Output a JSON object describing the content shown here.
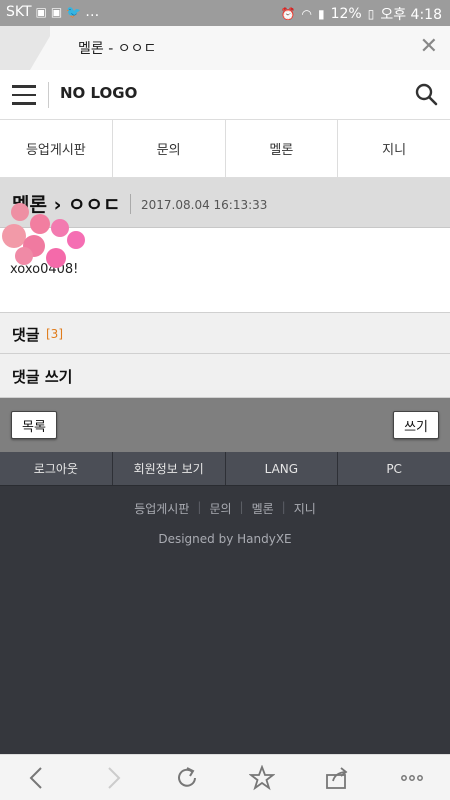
{
  "status_bar": {
    "carrier": "SKT",
    "battery": "12%",
    "time": "오후 4:18"
  },
  "tab": {
    "title": "멜론 - ㅇㅇㄷ"
  },
  "header": {
    "logo": "NO LOGO"
  },
  "nav": {
    "items": [
      {
        "label": "등업게시판"
      },
      {
        "label": "문의"
      },
      {
        "label": "멜론"
      },
      {
        "label": "지니"
      }
    ]
  },
  "post": {
    "title": "멜론 › ㅇㅇㄷ",
    "date": "2017.08.04 16:13:33",
    "body": "xoxo0408!"
  },
  "comments": {
    "label": "댓글",
    "count": "[3]",
    "write_label": "댓글 쓰기"
  },
  "actions": {
    "list_label": "목록",
    "write_label": "쓰기"
  },
  "footer_nav": {
    "items": [
      {
        "label": "로그아웃"
      },
      {
        "label": "회원정보 보기"
      },
      {
        "label": "LANG"
      },
      {
        "label": "PC"
      }
    ]
  },
  "footer": {
    "links": [
      {
        "label": "등업게시판"
      },
      {
        "label": "문의"
      },
      {
        "label": "멜론"
      },
      {
        "label": "지니"
      }
    ],
    "credit": "Designed by HandyXE"
  },
  "colors": {
    "accent_count": "#e07c1c",
    "footer_bg": "#35373d",
    "action_bar_bg": "#7f7f7f"
  }
}
